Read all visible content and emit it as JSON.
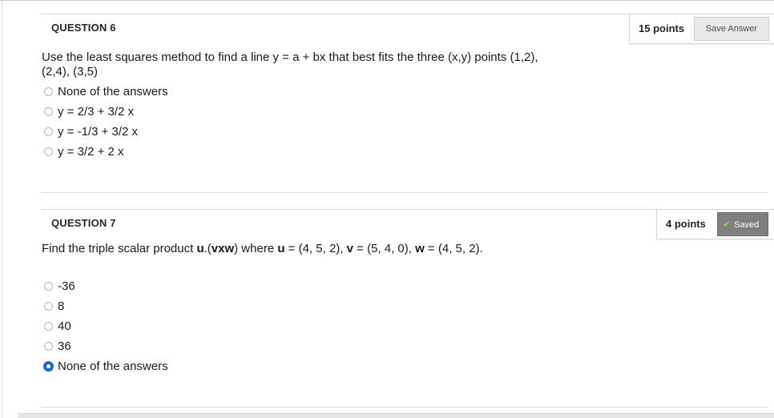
{
  "q6": {
    "title": "QUESTION 6",
    "points": "15 points",
    "save_label": "Save Answer",
    "text_line1": "Use the least squares method to find a line y = a + bx that best fits  the three (x,y) points (1,2),",
    "text_line2": "(2,4), (3,5)",
    "options": [
      {
        "label": "None of the answers",
        "selected": false
      },
      {
        "label": "y = 2/3 + 3/2 x",
        "selected": false
      },
      {
        "label": "y =  -1/3 + 3/2 x",
        "selected": false
      },
      {
        "label": "y = 3/2 + 2 x",
        "selected": false
      }
    ]
  },
  "q7": {
    "title": "QUESTION 7",
    "points": "4 points",
    "saved_label": "Saved",
    "text": {
      "p1": "Find the triple scalar product  ",
      "p2": "u",
      "p3": ".(",
      "p4": "vxw",
      "p5": ") where ",
      "p6": "u",
      "p7": " = (4, 5, 2), ",
      "p8": "v",
      "p9": " = (5, 4, 0), ",
      "p10": "w",
      "p11": " = (4, 5, 2)."
    },
    "options": [
      {
        "label": "-36",
        "selected": false
      },
      {
        "label": "8",
        "selected": false
      },
      {
        "label": "40",
        "selected": false
      },
      {
        "label": "36",
        "selected": false
      },
      {
        "label": "None of the answers",
        "selected": true
      }
    ]
  },
  "icons": {
    "saved_check": "check-icon"
  },
  "colors": {
    "selected_radio": "#1769d8",
    "saved_button": "#7f7f7f",
    "check": "#7ddc4a"
  }
}
